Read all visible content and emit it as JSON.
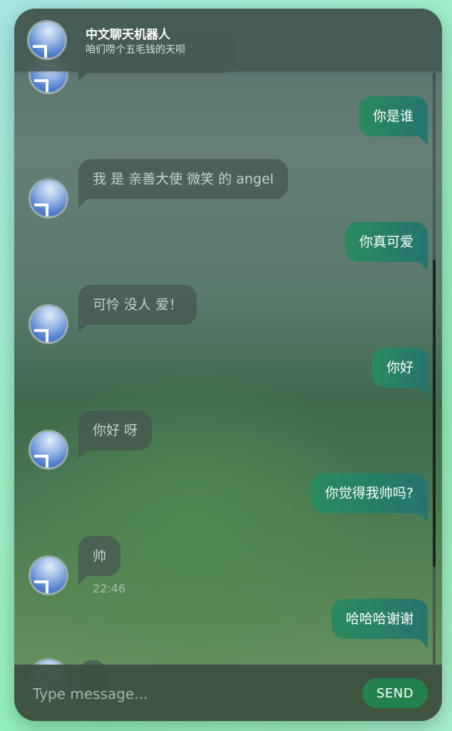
{
  "header": {
    "title": "中文聊天机器人",
    "subtitle": "咱们唠个五毛钱的天呗"
  },
  "messages": [
    {
      "sender": "user",
      "text": "你是谁"
    },
    {
      "sender": "bot",
      "text": "我 是 亲善大使 微笑 的 angel"
    },
    {
      "sender": "user",
      "text": "你真可爱"
    },
    {
      "sender": "bot",
      "text": "可怜 没人 爱！"
    },
    {
      "sender": "user",
      "text": "你好"
    },
    {
      "sender": "bot",
      "text": "你好 呀"
    },
    {
      "sender": "user",
      "text": "你觉得我帅吗?"
    },
    {
      "sender": "bot",
      "text": "帅",
      "time": "22:46"
    },
    {
      "sender": "user",
      "text": "哈哈哈谢谢"
    }
  ],
  "composer": {
    "placeholder": "Type message...",
    "send_label": "SEND"
  },
  "colors": {
    "user_bubble": "#26756f",
    "bot_bubble": "#46554f",
    "send_button": "#23804f"
  },
  "icons": {
    "avatar": "bot-avatar-icon"
  }
}
